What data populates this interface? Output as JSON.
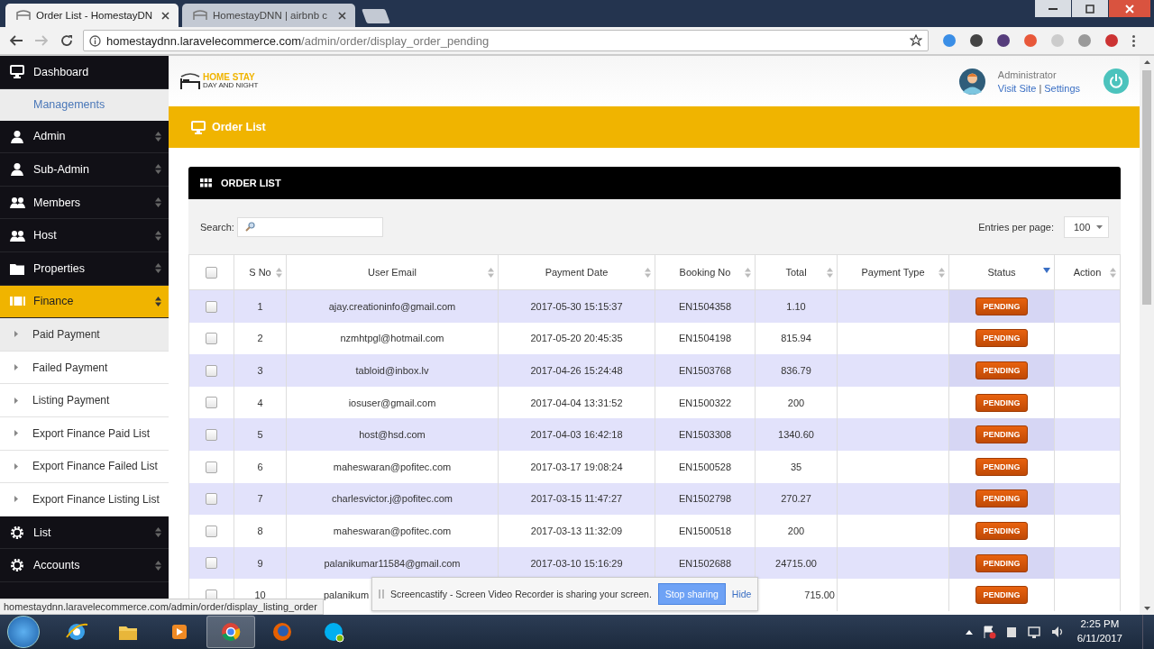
{
  "browser": {
    "tabs": [
      {
        "title": "Order List - HomestayDN",
        "selected": true
      },
      {
        "title": "HomestayDNN | airbnb c",
        "selected": false
      }
    ],
    "address": {
      "host": "homestaydnn.laravelecommerce.com",
      "path": "/admin/order/display_order_pending"
    }
  },
  "sidebar": {
    "items": [
      {
        "kind": "link",
        "label": "Dashboard"
      },
      {
        "kind": "heading",
        "label": "Managements"
      },
      {
        "kind": "menu",
        "label": "Admin",
        "selected": false
      },
      {
        "kind": "menu",
        "label": "Sub-Admin",
        "selected": false
      },
      {
        "kind": "menu",
        "label": "Members",
        "selected": false
      },
      {
        "kind": "menu",
        "label": "Host",
        "selected": false
      },
      {
        "kind": "menu",
        "label": "Properties",
        "selected": false
      },
      {
        "kind": "menu",
        "label": "Finance",
        "selected": true,
        "expanded": true,
        "children": [
          {
            "label": "Paid Payment",
            "selected": true
          },
          {
            "label": "Failed Payment",
            "selected": false
          },
          {
            "label": "Listing Payment",
            "selected": false
          },
          {
            "label": "Export Finance Paid List",
            "selected": false
          },
          {
            "label": "Export Finance Failed List",
            "selected": false
          },
          {
            "label": "Export Finance Listing List",
            "selected": false
          }
        ]
      },
      {
        "kind": "menu",
        "label": "List",
        "selected": false
      },
      {
        "kind": "menu",
        "label": "Accounts",
        "selected": false
      }
    ]
  },
  "header": {
    "logo": {
      "title": "HOME STAY",
      "tagline": "DAY AND NIGHT"
    },
    "user": {
      "name": "Administrator",
      "links": [
        "Visit Site",
        "Settings"
      ],
      "separator": "|"
    }
  },
  "page_title": "Order List",
  "panel": {
    "title": "ORDER LIST",
    "search_label": "Search:",
    "entries_label": "Entries per page:",
    "entries_value": "100",
    "table": {
      "header_checked": false,
      "columns": [
        {
          "label": "S No",
          "sorted": false
        },
        {
          "label": "User Email",
          "sorted": false
        },
        {
          "label": "Payment Date",
          "sorted": false
        },
        {
          "label": "Booking No",
          "sorted": false
        },
        {
          "label": "Total",
          "sorted": false
        },
        {
          "label": "Payment Type",
          "sorted": false
        },
        {
          "label": "Status",
          "sorted": true
        },
        {
          "label": "Action",
          "sorted": false
        }
      ],
      "rows": [
        {
          "checked": false,
          "s_no": "1",
          "email": "ajay.creationinfo@gmail.com",
          "date": "2017-05-30 15:15:37",
          "booking": "EN1504358",
          "total": "1.10",
          "status": "PENDING"
        },
        {
          "checked": false,
          "s_no": "2",
          "email": "nzmhtpgl@hotmail.com",
          "date": "2017-05-20 20:45:35",
          "booking": "EN1504198",
          "total": "815.94",
          "status": "PENDING"
        },
        {
          "checked": false,
          "s_no": "3",
          "email": "tabloid@inbox.lv",
          "date": "2017-04-26 15:24:48",
          "booking": "EN1503768",
          "total": "836.79",
          "status": "PENDING"
        },
        {
          "checked": false,
          "s_no": "4",
          "email": "iosuser@gmail.com",
          "date": "2017-04-04 13:31:52",
          "booking": "EN1500322",
          "total": "200",
          "status": "PENDING"
        },
        {
          "checked": false,
          "s_no": "5",
          "email": "host@hsd.com",
          "date": "2017-04-03 16:42:18",
          "booking": "EN1503308",
          "total": "1340.60",
          "status": "PENDING"
        },
        {
          "checked": false,
          "s_no": "6",
          "email": "maheswaran@pofitec.com",
          "date": "2017-03-17 19:08:24",
          "booking": "EN1500528",
          "total": "35",
          "status": "PENDING"
        },
        {
          "checked": false,
          "s_no": "7",
          "email": "charlesvictor.j@pofitec.com",
          "date": "2017-03-15 11:47:27",
          "booking": "EN1502798",
          "total": "270.27",
          "status": "PENDING"
        },
        {
          "checked": false,
          "s_no": "8",
          "email": "maheswaran@pofitec.com",
          "date": "2017-03-13 11:32:09",
          "booking": "EN1500518",
          "total": "200",
          "status": "PENDING"
        },
        {
          "checked": false,
          "s_no": "9",
          "email": "palanikumar11584@gmail.com",
          "date": "2017-03-10 15:16:29",
          "booking": "EN1502688",
          "total": "24715.00",
          "status": "PENDING"
        },
        {
          "checked": false,
          "s_no": "10",
          "email": "palanikum",
          "total": "715.00",
          "status": "PENDING"
        }
      ]
    }
  },
  "infobar": {
    "message": "Screencastify - Screen Video Recorder is sharing your screen.",
    "button": "Stop sharing",
    "link": "Hide"
  },
  "status_url": "homestaydnn.laravelecommerce.com/admin/order/display_listing_order",
  "taskbar": {
    "apps": [
      {
        "selected": false
      },
      {
        "selected": false
      },
      {
        "selected": false
      },
      {
        "selected": true
      },
      {
        "selected": false
      },
      {
        "selected": false
      }
    ],
    "time": "2:25 PM",
    "date": "6/11/2017"
  }
}
